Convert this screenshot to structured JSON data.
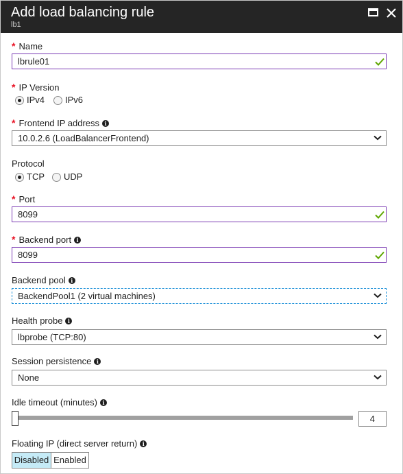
{
  "header": {
    "title": "Add load balancing rule",
    "subtitle": "lb1"
  },
  "form": {
    "name": {
      "label": "Name",
      "value": "lbrule01",
      "required": true
    },
    "ip_version": {
      "label": "IP Version",
      "required": true,
      "options": [
        "IPv4",
        "IPv6"
      ],
      "selected": "IPv4"
    },
    "frontend_ip": {
      "label": "Frontend IP address",
      "required": true,
      "value": "10.0.2.6 (LoadBalancerFrontend)"
    },
    "protocol": {
      "label": "Protocol",
      "options": [
        "TCP",
        "UDP"
      ],
      "selected": "TCP"
    },
    "port": {
      "label": "Port",
      "value": "8099",
      "required": true
    },
    "backend_port": {
      "label": "Backend port",
      "value": "8099",
      "required": true
    },
    "backend_pool": {
      "label": "Backend pool",
      "value": "BackendPool1 (2 virtual machines)"
    },
    "health_probe": {
      "label": "Health probe",
      "value": "lbprobe (TCP:80)"
    },
    "session_persistence": {
      "label": "Session persistence",
      "value": "None"
    },
    "idle_timeout": {
      "label": "Idle timeout (minutes)",
      "value": "4"
    },
    "floating_ip": {
      "label": "Floating IP (direct server return)",
      "options": [
        "Disabled",
        "Enabled"
      ],
      "selected": "Disabled"
    }
  },
  "symbols": {
    "required_marker": "*",
    "info_marker": "i"
  },
  "colors": {
    "header_bg": "#252525",
    "required": "#e81123",
    "valid_check": "#5ea600",
    "input_border_active": "#7a3ab3",
    "selected_toggle": "#c5ebf7"
  }
}
